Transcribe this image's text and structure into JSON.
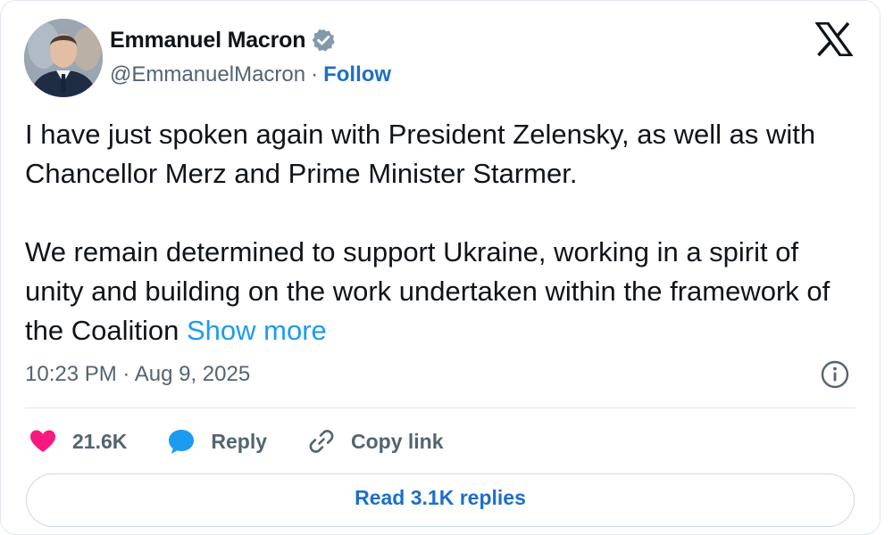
{
  "author": {
    "name": "Emmanuel Macron",
    "handle": "@EmmanuelMacron",
    "separator": "·",
    "follow_label": "Follow"
  },
  "tweet": {
    "paragraph1": "I have just spoken again with President Zelensky, as well as with Chancellor Merz and Prime Minister Starmer.",
    "paragraph2": "We remain determined to support Ukraine, working in a spirit of unity and building on the work undertaken within the framework of the Coalition",
    "show_more_label": "Show more",
    "timestamp": "10:23 PM · Aug 9, 2025"
  },
  "actions": {
    "likes": "21.6K",
    "reply_label": "Reply",
    "copy_link_label": "Copy link"
  },
  "replies_button_label": "Read 3.1K replies",
  "colors": {
    "link_blue": "#1d6fc9",
    "show_more_blue": "#1d9bf0",
    "like_pink": "#f91880",
    "reply_blue": "#1d9bf0",
    "muted_gray": "#536471"
  },
  "icons": [
    "verified-badge-icon",
    "x-logo-icon",
    "info-icon",
    "heart-icon",
    "reply-bubble-icon",
    "link-icon"
  ]
}
